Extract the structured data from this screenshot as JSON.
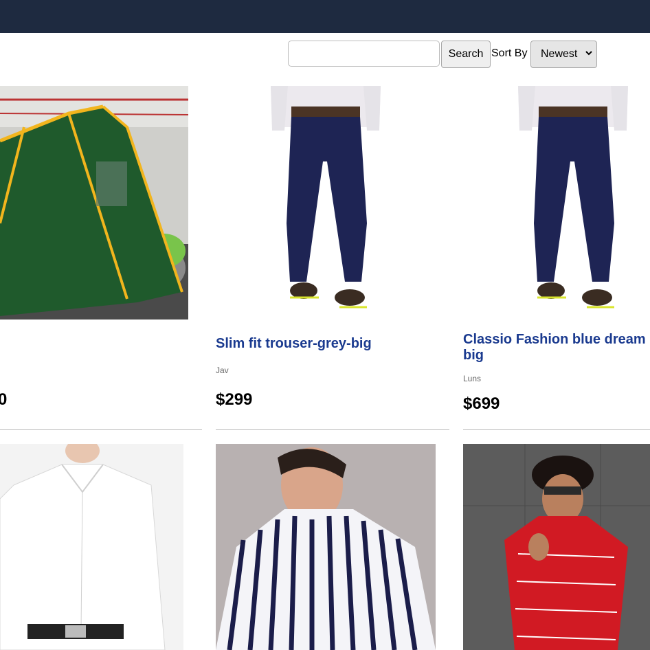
{
  "toolbar": {
    "search_placeholder": "",
    "search_label": "Search",
    "sort_label": "Sort By",
    "sort_selected": "Newest"
  },
  "products": [
    {
      "name": "",
      "brand": "",
      "price": "0",
      "image": "green-tent-photo"
    },
    {
      "name": "Slim fit trouser-grey-big",
      "brand": "Jav",
      "price": "$299",
      "image": "navy-trousers-photo"
    },
    {
      "name": "Classio Fashion blue dream big",
      "brand": "Luns",
      "price": "$699",
      "image": "navy-trousers-photo"
    },
    {
      "name": "",
      "brand": "",
      "price": "",
      "image": "white-shirt-photo"
    },
    {
      "name": "",
      "brand": "",
      "price": "",
      "image": "striped-shirt-photo"
    },
    {
      "name": "",
      "brand": "",
      "price": "",
      "image": "red-print-shirt-photo"
    }
  ],
  "colors": {
    "header": "#1e2a40",
    "title": "#1a3a8f",
    "rule": "#bdbdbd"
  }
}
